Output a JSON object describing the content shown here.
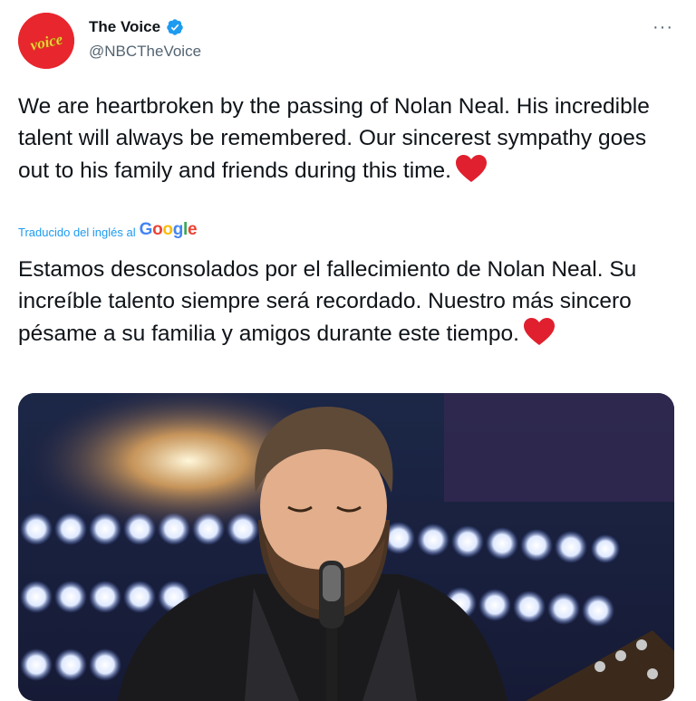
{
  "account": {
    "display_name": "The Voice",
    "handle": "@NBCTheVoice",
    "avatar_text": "voice"
  },
  "tweet": {
    "text": "We are heartbroken by the passing of Nolan Neal. His incredible talent will always be remembered. Our sincerest sympathy goes out to his family and friends during this time.",
    "translated_label": "Traducido del inglés al",
    "translation_provider": "Google",
    "translated_text": "Estamos desconsolados por el fallecimiento de Nolan Neal. Su increíble talento siempre será recordado. Nuestro más sincero pésame a su familia y amigos durante este tiempo."
  },
  "icons": {
    "more": "more-options-icon",
    "verified": "verified-badge-icon",
    "heart": "red-heart-emoji"
  },
  "colors": {
    "accent": "#1d9bf0",
    "heart": "#e0202e",
    "avatar_bg": "#e8262d"
  }
}
